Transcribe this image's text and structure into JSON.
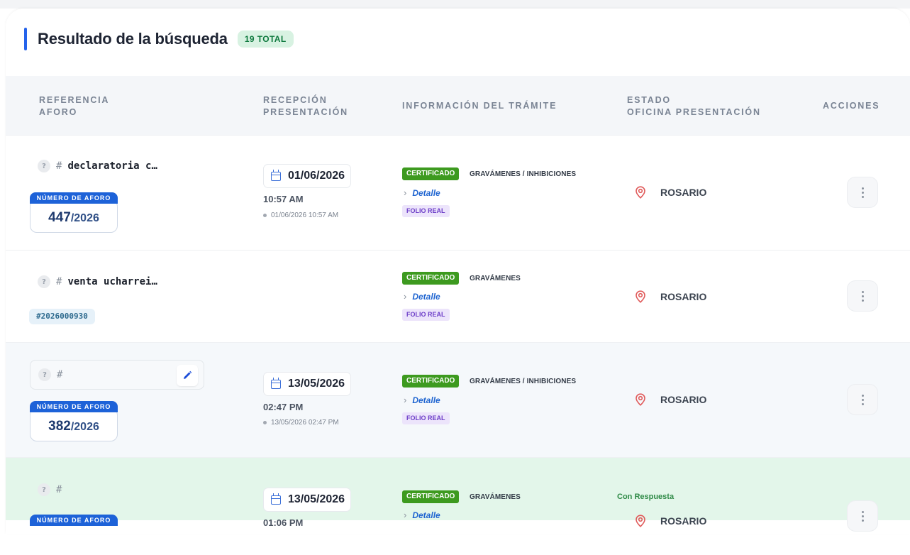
{
  "header": {
    "title": "Resultado de la búsqueda",
    "total_badge": "19 TOTAL"
  },
  "columns": {
    "referencia": [
      "REFERENCIA",
      "AFORO"
    ],
    "recepcion": [
      "RECEPCIÓN",
      "PRESENTACIÓN"
    ],
    "informacion": "INFORMACIÓN DEL TRÁMITE",
    "estado": [
      "ESTADO",
      "OFICINA PRESENTACIÓN"
    ],
    "acciones": "ACCIONES"
  },
  "aforo_label": "NÚMERO DE AFORO",
  "detalle_label": "Detalle",
  "cert_label": "CERTIFICADO",
  "folio_label": "FOLIO REAL",
  "rows": [
    {
      "reference": "declaratoria c…",
      "aforo_number": "447",
      "aforo_year": "/2026",
      "date": "01/06/2026",
      "time": "10:57 AM",
      "presentation": "01/06/2026 10:57 AM",
      "tramite_type": "GRAVÁMENES / INHIBICIONES",
      "estado": "",
      "oficina": "ROSARIO"
    },
    {
      "reference": "venta ucharrei…",
      "chip": "#2026000930",
      "tramite_type": "GRAVÁMENES",
      "estado": "",
      "oficina": "ROSARIO"
    },
    {
      "reference": "",
      "aforo_number": "382",
      "aforo_year": "/2026",
      "date": "13/05/2026",
      "time": "02:47 PM",
      "presentation": "13/05/2026 02:47 PM",
      "tramite_type": "GRAVÁMENES / INHIBICIONES",
      "estado": "",
      "oficina": "ROSARIO"
    },
    {
      "reference": "",
      "aforo_number": "",
      "date": "13/05/2026",
      "time": "01:06 PM",
      "tramite_type": "GRAVÁMENES",
      "estado": "Con Respuesta",
      "oficina": "ROSARIO"
    }
  ],
  "colors": {
    "accent": "#2563eb",
    "certificado": "#3d9a1f",
    "folio": "#6d3fc8",
    "pin": "#e05a5a",
    "row_highlight": "#e3f6ea"
  },
  "icons": [
    "help-icon",
    "edit-pencil-icon",
    "calendar-icon",
    "chevron-right-icon",
    "location-pin-icon",
    "kebab-menu-icon"
  ]
}
